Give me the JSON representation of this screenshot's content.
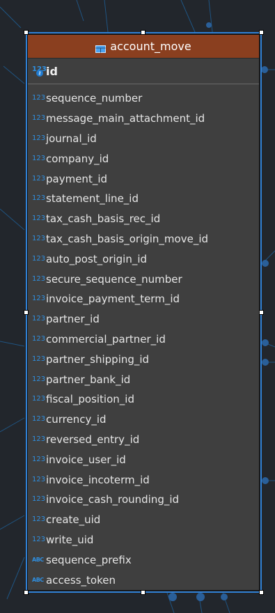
{
  "entity": {
    "name": "account_move",
    "primary_key": {
      "name": "id",
      "type_label": "123"
    },
    "columns": [
      {
        "name": "sequence_number",
        "type_label": "123"
      },
      {
        "name": "message_main_attachment_id",
        "type_label": "123"
      },
      {
        "name": "journal_id",
        "type_label": "123"
      },
      {
        "name": "company_id",
        "type_label": "123"
      },
      {
        "name": "payment_id",
        "type_label": "123"
      },
      {
        "name": "statement_line_id",
        "type_label": "123"
      },
      {
        "name": "tax_cash_basis_rec_id",
        "type_label": "123"
      },
      {
        "name": "tax_cash_basis_origin_move_id",
        "type_label": "123"
      },
      {
        "name": "auto_post_origin_id",
        "type_label": "123"
      },
      {
        "name": "secure_sequence_number",
        "type_label": "123"
      },
      {
        "name": "invoice_payment_term_id",
        "type_label": "123"
      },
      {
        "name": "partner_id",
        "type_label": "123"
      },
      {
        "name": "commercial_partner_id",
        "type_label": "123"
      },
      {
        "name": "partner_shipping_id",
        "type_label": "123"
      },
      {
        "name": "partner_bank_id",
        "type_label": "123"
      },
      {
        "name": "fiscal_position_id",
        "type_label": "123"
      },
      {
        "name": "currency_id",
        "type_label": "123"
      },
      {
        "name": "reversed_entry_id",
        "type_label": "123"
      },
      {
        "name": "invoice_user_id",
        "type_label": "123"
      },
      {
        "name": "invoice_incoterm_id",
        "type_label": "123"
      },
      {
        "name": "invoice_cash_rounding_id",
        "type_label": "123"
      },
      {
        "name": "create_uid",
        "type_label": "123"
      },
      {
        "name": "write_uid",
        "type_label": "123"
      },
      {
        "name": "sequence_prefix",
        "type_label": "ABC"
      },
      {
        "name": "access_token",
        "type_label": "ABC"
      }
    ]
  },
  "colors": {
    "header_bg": "#8a3f1f",
    "entity_bg": "#3f3f3f",
    "selection": "#2f7fd3",
    "type_badge": "#2f8fe0",
    "canvas_bg": "#22262c"
  }
}
